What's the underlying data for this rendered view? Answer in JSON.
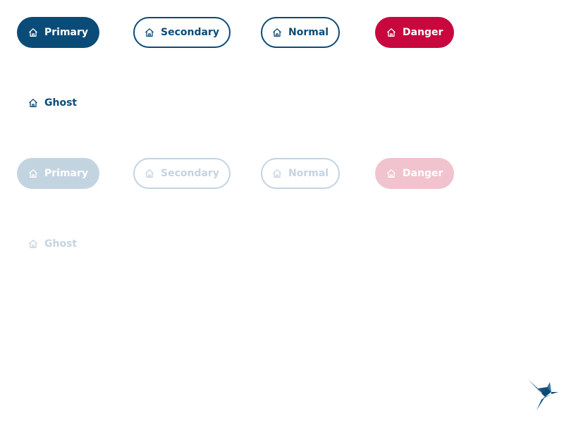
{
  "buttons": {
    "enabled": {
      "primary": "Primary",
      "secondary": "Secondary",
      "normal": "Normal",
      "danger": "Danger",
      "ghost": "Ghost"
    },
    "disabled": {
      "primary": "Primary",
      "secondary": "Secondary",
      "normal": "Normal",
      "danger": "Danger",
      "ghost": "Ghost"
    }
  },
  "icons": {
    "button_icon": "home-icon",
    "logo": "hummingbird-logo"
  },
  "colors": {
    "primary": "#0a4b78",
    "danger": "#c8073e",
    "primary_disabled": "#c3d4e1",
    "danger_disabled": "#f0c3cf"
  }
}
